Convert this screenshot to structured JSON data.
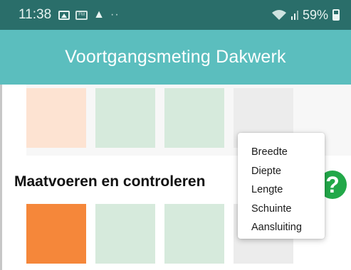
{
  "status_bar": {
    "time": "11:38",
    "dots": "··",
    "battery": "59%",
    "icons": [
      "image-icon",
      "fm-radio-icon",
      "warning-icon",
      "wifi-icon",
      "signal-icon",
      "battery-icon"
    ]
  },
  "app_bar": {
    "title": "Voortgangsmeting Dakwerk"
  },
  "section": {
    "heading": "Maatvoeren en controleren"
  },
  "tiles_top": [
    "#fde3d2",
    "#d6eadc",
    "#d6eadc",
    "#ececec"
  ],
  "tiles_bottom": [
    "#f5873a",
    "#d6eadc",
    "#d6eadc",
    "#ececec"
  ],
  "menu": {
    "items": [
      "Breedte",
      "Diepte",
      "Lengte",
      "Schuinte",
      "Aansluiting"
    ]
  },
  "help": {
    "glyph": "?",
    "color": "#22a849"
  },
  "colors": {
    "status_bar": "#2a6e6a",
    "app_bar": "#5bbebe"
  }
}
